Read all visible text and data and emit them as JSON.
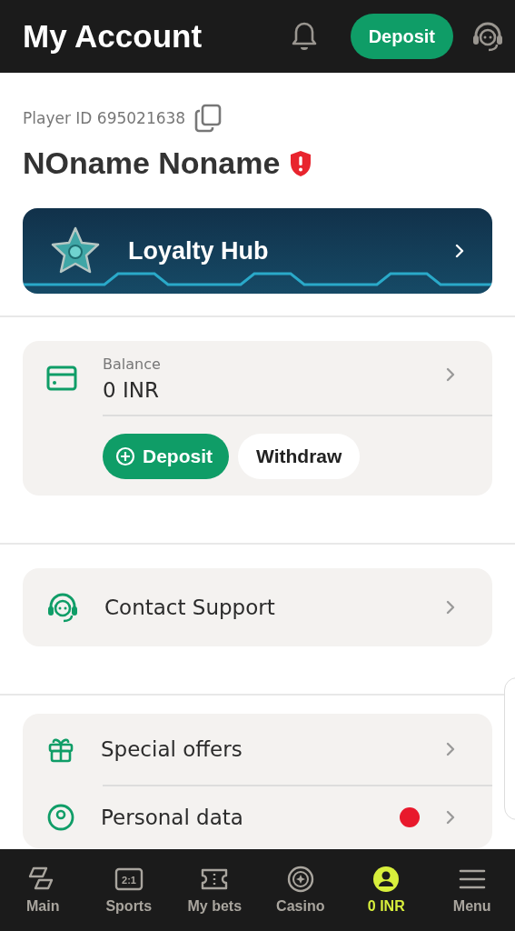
{
  "header": {
    "title": "My Account",
    "deposit_button": "Deposit"
  },
  "profile": {
    "player_id": "Player ID 695021638",
    "name": "NOname Noname",
    "unverified": true
  },
  "loyalty": {
    "label": "Loyalty Hub"
  },
  "balance": {
    "label": "Balance",
    "amount": "0 INR",
    "deposit_button": "Deposit",
    "withdraw_button": "Withdraw"
  },
  "support": {
    "label": "Contact Support"
  },
  "menu_items": [
    {
      "kind": "gift",
      "label": "Special offers",
      "alert": false
    },
    {
      "kind": "person",
      "label": "Personal data",
      "alert": true
    }
  ],
  "bottom_nav": [
    {
      "kind": "main",
      "label": "Main",
      "selected": false
    },
    {
      "kind": "sports",
      "label": "Sports",
      "icon_text": "2:1",
      "selected": false
    },
    {
      "kind": "bets",
      "label": "My bets",
      "selected": false
    },
    {
      "kind": "casino",
      "label": "Casino",
      "selected": false
    },
    {
      "kind": "account",
      "label": "0 INR",
      "selected": true
    },
    {
      "kind": "menu",
      "label": "Menu",
      "selected": false
    }
  ]
}
